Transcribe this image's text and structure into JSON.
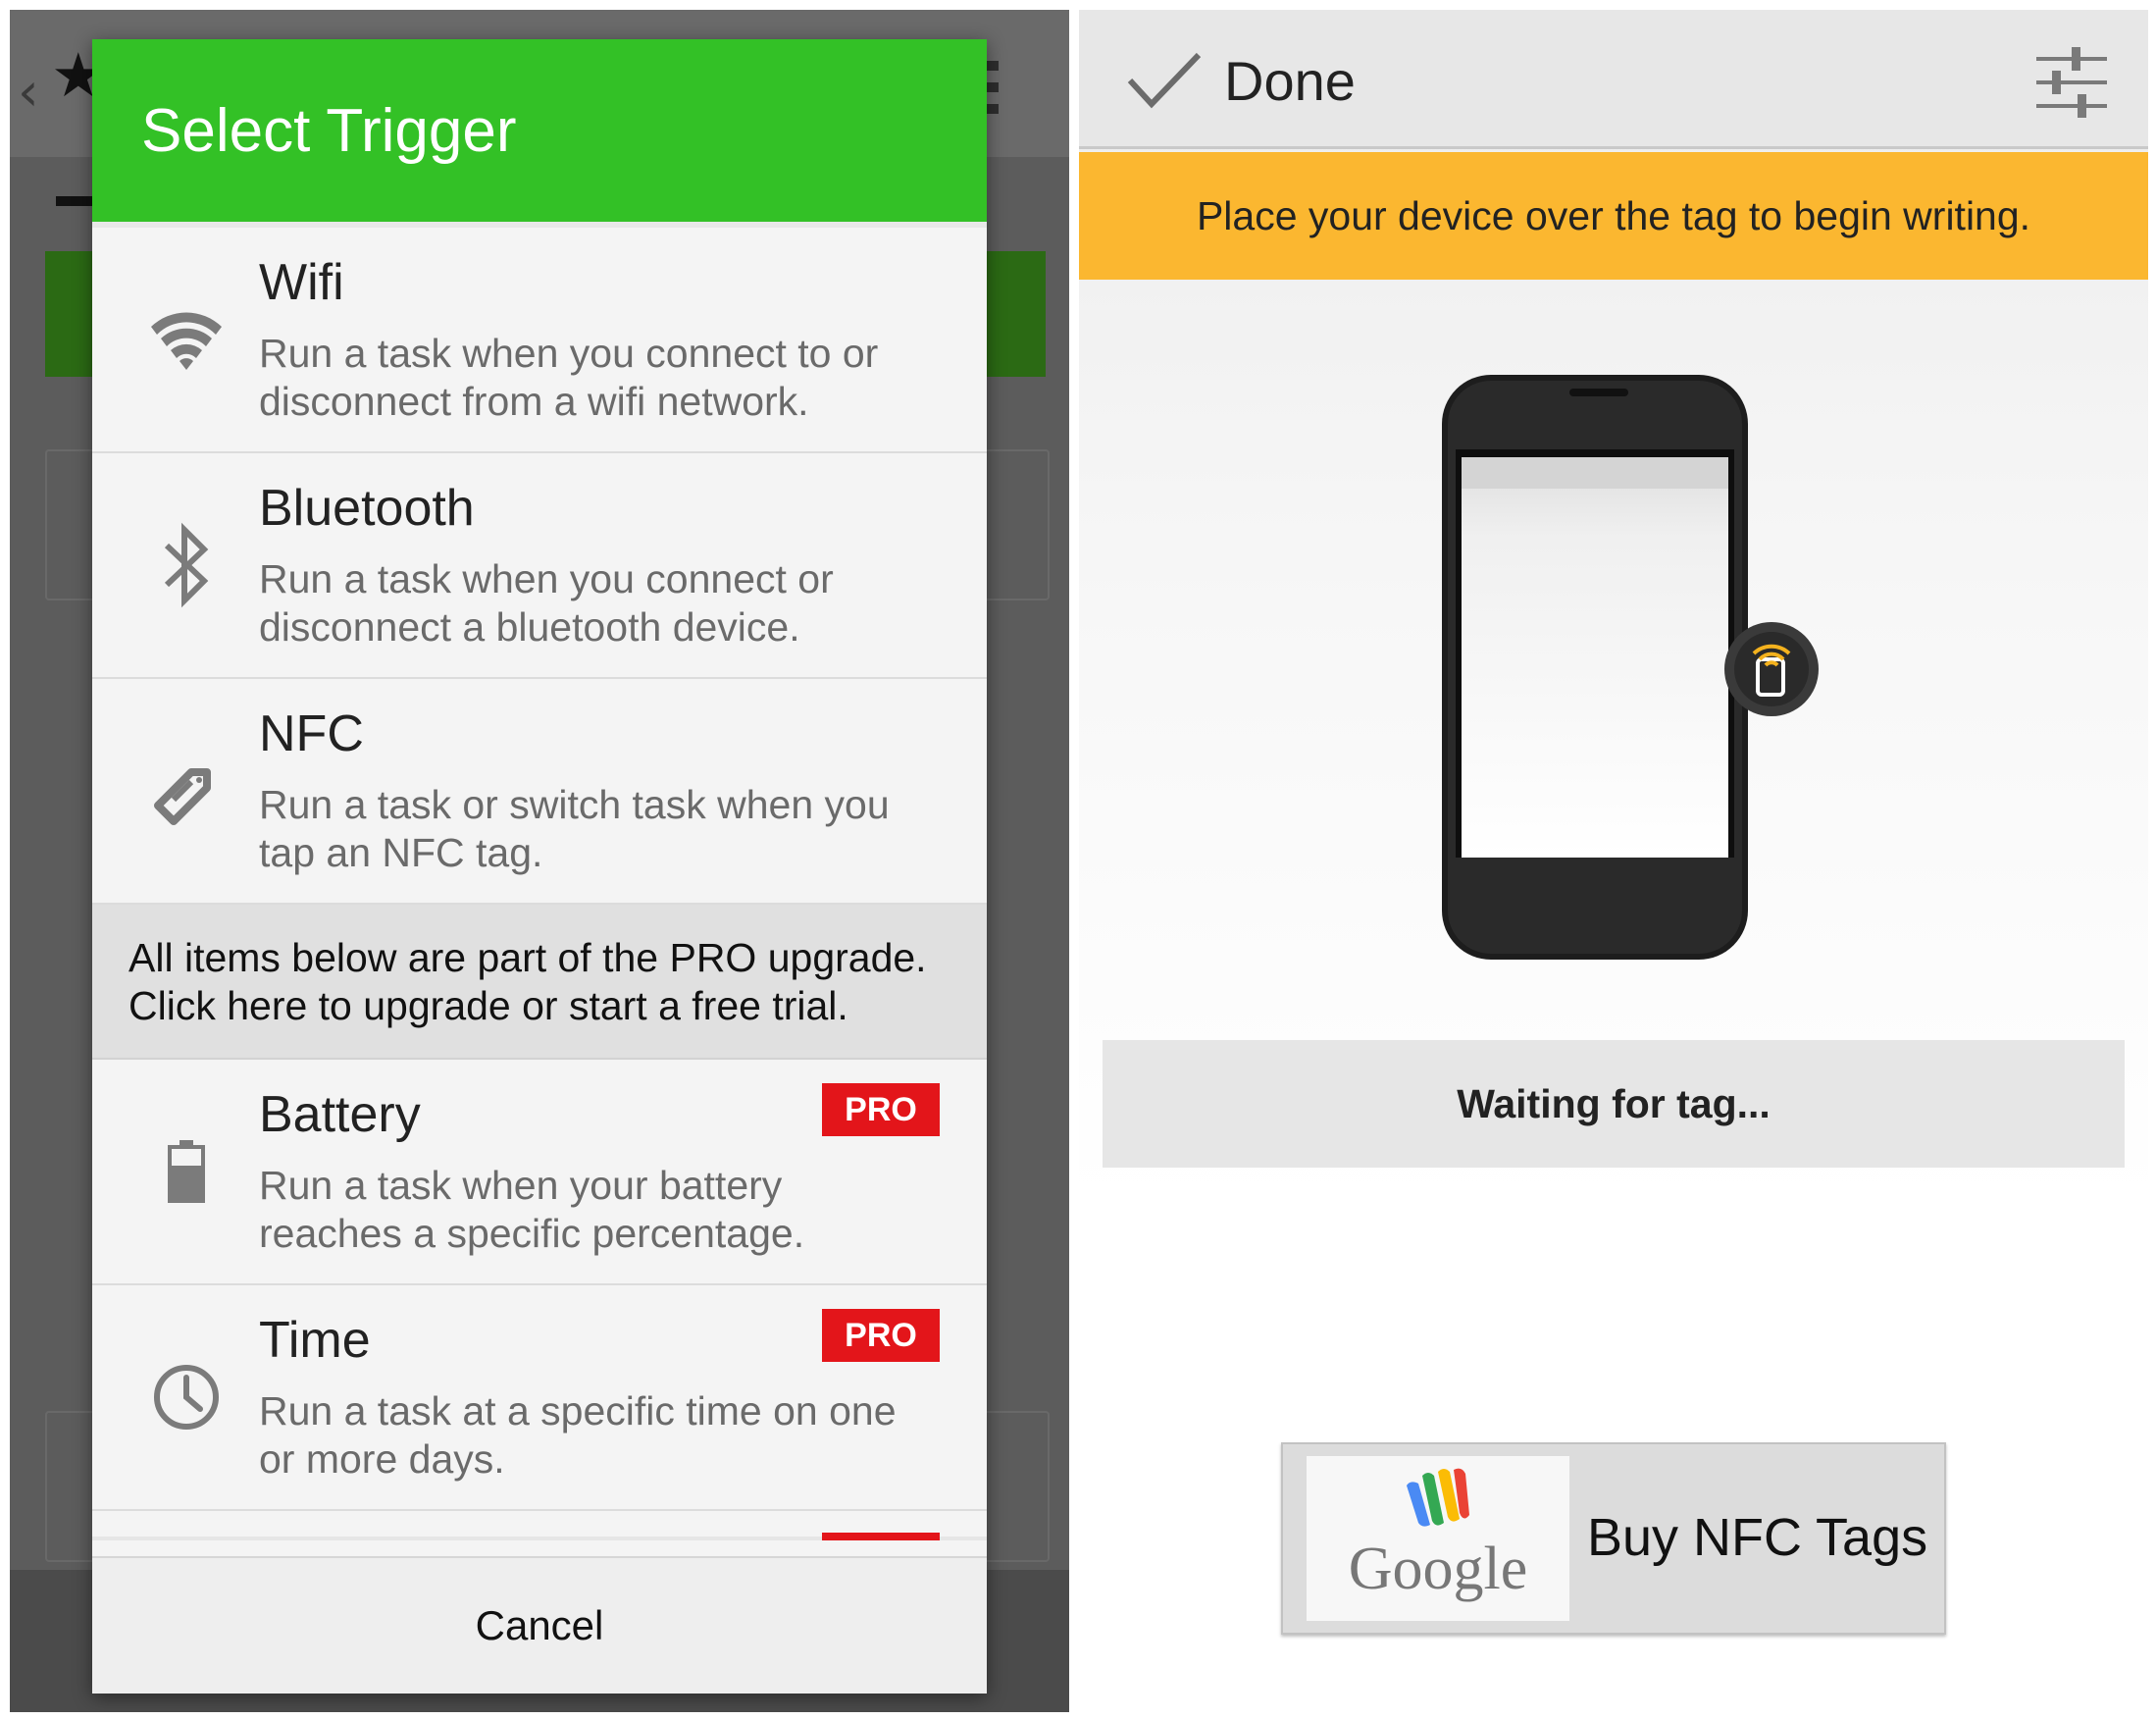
{
  "select_trigger": {
    "title": "Select Trigger",
    "items": [
      {
        "title": "Wifi",
        "description": "Run a task when you connect to or disconnect from a wifi network.",
        "icon": "wifi-icon"
      },
      {
        "title": "Bluetooth",
        "description": "Run a task when you connect or disconnect a bluetooth device.",
        "icon": "bluetooth-icon"
      },
      {
        "title": "NFC",
        "description": "Run a task or switch task when you tap an NFC tag.",
        "icon": "nfc-tag-icon"
      }
    ],
    "pro_banner": {
      "line1": "All items below are part of the PRO upgrade.",
      "line2": "Click here to upgrade or start a free trial."
    },
    "pro_items": [
      {
        "title": "Battery",
        "description": "Run a task when your battery reaches a specific percentage.",
        "badge": "PRO",
        "icon": "battery-icon"
      },
      {
        "title": "Time",
        "description": "Run a task at a specific time on one or more days.",
        "badge": "PRO",
        "icon": "clock-icon"
      }
    ],
    "cancel_label": "Cancel",
    "accent_color": "#33c126",
    "pro_color": "#e3151a"
  },
  "nfc_writer": {
    "done_label": "Done",
    "instruction": "Place your device over the tag to begin writing.",
    "status": "Waiting for tag...",
    "buy_button": {
      "logo_text": "Google",
      "label": "Buy NFC Tags"
    },
    "banner_color": "#fbb730"
  }
}
